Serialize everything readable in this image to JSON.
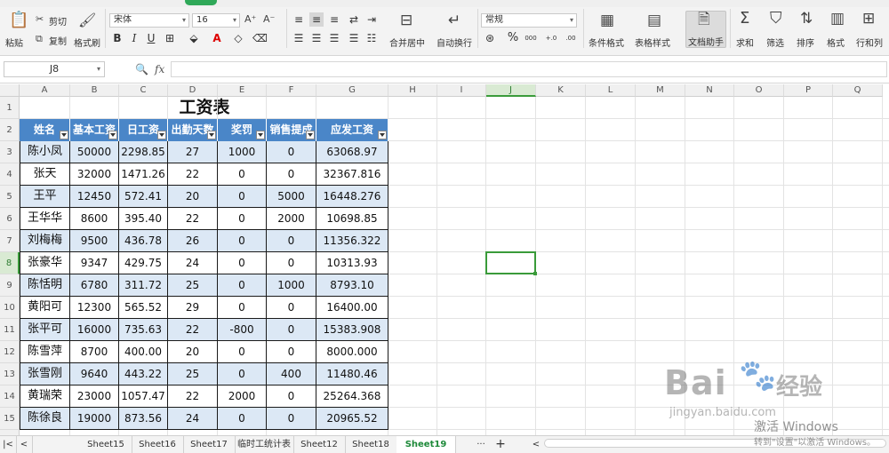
{
  "ribbon": {
    "paste": "粘贴",
    "cut": "剪切",
    "copy": "复制",
    "format_painter": "格式刷",
    "font_name": "宋体",
    "font_size": "16",
    "bold": "B",
    "italic": "I",
    "underline": "U",
    "merge_center": "合并居中",
    "wrap_text": "自动换行",
    "number_format": "常规",
    "percent": "%",
    "thousands": "000",
    "inc_decimal": "+.0",
    "dec_decimal": ".00",
    "conditional_format": "条件格式",
    "table_style": "表格样式",
    "doc_helper": "文档助手",
    "sum": "求和",
    "filter": "筛选",
    "sort": "排序",
    "format": "格式",
    "row_col": "行和列"
  },
  "formula_bar": {
    "name_box": "J8",
    "fx": "fx",
    "value": ""
  },
  "columns": [
    "A",
    "B",
    "C",
    "D",
    "E",
    "F",
    "G",
    "H",
    "I",
    "J",
    "K",
    "L",
    "M",
    "N",
    "O",
    "P",
    "Q"
  ],
  "rows": [
    "1",
    "2",
    "3",
    "4",
    "5",
    "6",
    "7",
    "8",
    "9",
    "10",
    "11",
    "12",
    "13",
    "14",
    "15",
    "16"
  ],
  "selected_cell": {
    "col": "J",
    "row": "8"
  },
  "table": {
    "title": "工资表",
    "headers": [
      "姓名",
      "基本工资",
      "日工资",
      "出勤天数",
      "奖罚",
      "销售提成",
      "应发工资"
    ],
    "rows": [
      [
        "陈小凤",
        "50000",
        "2298.85",
        "27",
        "1000",
        "0",
        "63068.97"
      ],
      [
        "张天",
        "32000",
        "1471.26",
        "22",
        "0",
        "0",
        "32367.816"
      ],
      [
        "王平",
        "12450",
        "572.41",
        "20",
        "0",
        "5000",
        "16448.276"
      ],
      [
        "王华华",
        "8600",
        "395.40",
        "22",
        "0",
        "2000",
        "10698.85"
      ],
      [
        "刘梅梅",
        "9500",
        "436.78",
        "26",
        "0",
        "0",
        "11356.322"
      ],
      [
        "张豪华",
        "9347",
        "429.75",
        "24",
        "0",
        "0",
        "10313.93"
      ],
      [
        "陈恬明",
        "6780",
        "311.72",
        "25",
        "0",
        "1000",
        "8793.10"
      ],
      [
        "黄阳可",
        "12300",
        "565.52",
        "29",
        "0",
        "0",
        "16400.00"
      ],
      [
        "张平可",
        "16000",
        "735.63",
        "22",
        "-800",
        "0",
        "15383.908"
      ],
      [
        "陈雪萍",
        "8700",
        "400.00",
        "20",
        "0",
        "0",
        "8000.000"
      ],
      [
        "张雪刚",
        "9640",
        "443.22",
        "25",
        "0",
        "400",
        "11480.46"
      ],
      [
        "黄瑞荣",
        "23000",
        "1057.47",
        "22",
        "2000",
        "0",
        "25264.368"
      ],
      [
        "陈徐良",
        "19000",
        "873.56",
        "24",
        "0",
        "0",
        "20965.52"
      ]
    ]
  },
  "sheets": [
    "Sheet15",
    "Sheet16",
    "Sheet17",
    "临时工统计表",
    "Sheet12",
    "Sheet18",
    "Sheet19"
  ],
  "active_sheet": "Sheet19",
  "watermark": {
    "brand": "Bai",
    "brand_cn": "经验",
    "url": "jingyan.baidu.com"
  },
  "activation": {
    "line1": "激活 Windows",
    "line2": "转到\"设置\"以激活 Windows。"
  },
  "colors": {
    "header_blue": "#4a86c8",
    "alt_row": "#dce8f5",
    "selection_green": "#3a9b3a",
    "active_tab_green": "#2fa858"
  }
}
